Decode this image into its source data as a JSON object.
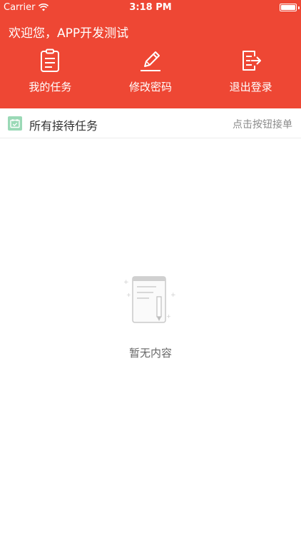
{
  "status_bar": {
    "carrier": "Carrier",
    "time": "3:18 PM",
    "battery_level": 1.0
  },
  "header": {
    "welcome": "欢迎您，APP开发测试",
    "background_color": "#ee4734",
    "actions": [
      {
        "label": "我的任务",
        "icon": "clipboard-icon"
      },
      {
        "label": "修改密码",
        "icon": "pencil-icon"
      },
      {
        "label": "退出登录",
        "icon": "logout-icon"
      }
    ]
  },
  "section": {
    "title": "所有接待任务",
    "hint": "点击按钮接单",
    "icon": "calendar-icon",
    "icon_color": "#9ad9b6"
  },
  "empty_state": {
    "text": "暂无内容",
    "icon": "notebook-icon"
  }
}
